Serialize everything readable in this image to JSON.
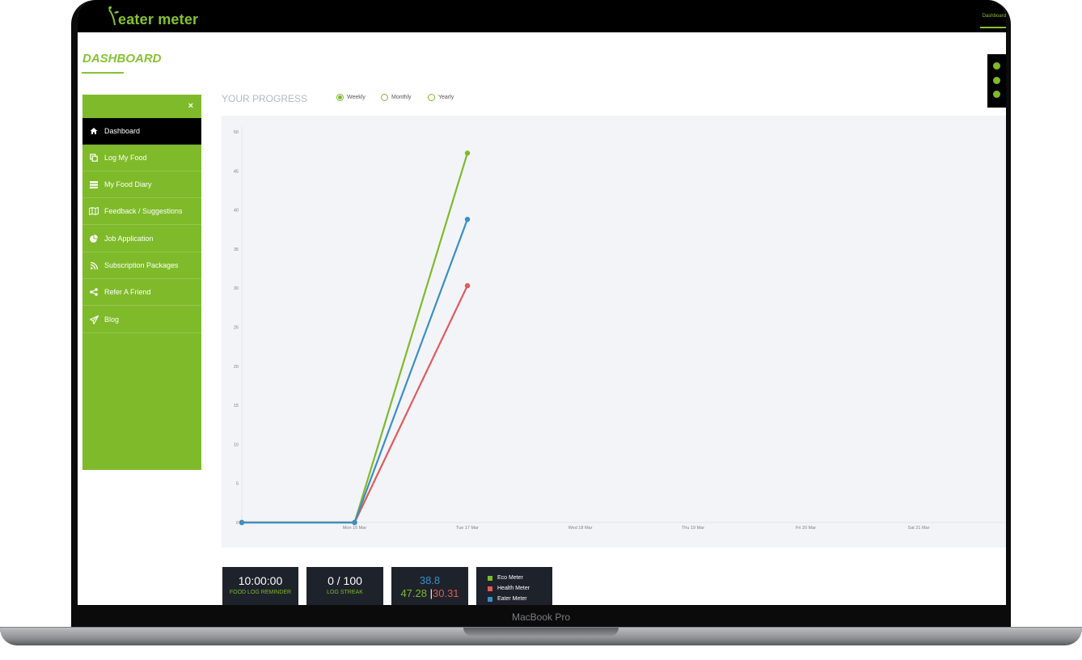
{
  "app": {
    "logo_text": "eater meter",
    "top_nav_link": "Dashboard",
    "page_title": "DASHBOARD"
  },
  "sidebar": {
    "close": "×",
    "items": [
      {
        "label": "Dashboard",
        "icon": "home-icon",
        "active": true
      },
      {
        "label": "Log My Food",
        "icon": "copy-icon",
        "active": false
      },
      {
        "label": "My Food Diary",
        "icon": "list-icon",
        "active": false
      },
      {
        "label": "Feedback / Suggestions",
        "icon": "map-icon",
        "active": false
      },
      {
        "label": "Job Application",
        "icon": "pie-chart-icon",
        "active": false
      },
      {
        "label": "Subscription Packages",
        "icon": "rss-icon",
        "active": false
      },
      {
        "label": "Refer A Friend",
        "icon": "share-icon",
        "active": false
      },
      {
        "label": "Blog",
        "icon": "paper-plane-icon",
        "active": false
      }
    ]
  },
  "progress": {
    "title": "YOUR PROGRESS",
    "options": [
      "Weekly",
      "Monthly",
      "Yearly"
    ],
    "selected": "Weekly"
  },
  "chart_data": {
    "type": "line",
    "categories": [
      "",
      "Mon 16 Mar",
      "Tue 17 Mar",
      "Wed 18 Mar",
      "Thu 19 Mar",
      "Fri 20 Mar",
      "Sat 21 Mar"
    ],
    "ylim": [
      0,
      50
    ],
    "yticks": [
      0,
      5,
      10,
      15,
      20,
      25,
      30,
      35,
      40,
      45,
      50
    ],
    "grid": false,
    "series": [
      {
        "name": "Eco Meter",
        "color": "#7fba2a",
        "values": [
          0,
          0,
          47.28
        ]
      },
      {
        "name": "Health Meter",
        "color": "#e05a5a",
        "values": [
          0,
          0,
          30.31
        ]
      },
      {
        "name": "Eater Meter",
        "color": "#3a8fc6",
        "values": [
          0,
          0,
          38.8
        ]
      }
    ]
  },
  "stats": {
    "reminder_time": "10:00:00",
    "reminder_label": "FOOD LOG REMINDER",
    "streak_value": "0 / 100",
    "streak_label": "LOG STREAK",
    "eater_value": "38.8",
    "eco_value": "47.28",
    "separator": "|",
    "health_value": "30.31"
  },
  "legend": [
    {
      "label": "Eco Meter",
      "color": "#7fba2a"
    },
    {
      "label": "Health Meter",
      "color": "#e05a5a"
    },
    {
      "label": "Eater Meter",
      "color": "#3a8fc6"
    }
  ],
  "device_label": "MacBook Pro"
}
